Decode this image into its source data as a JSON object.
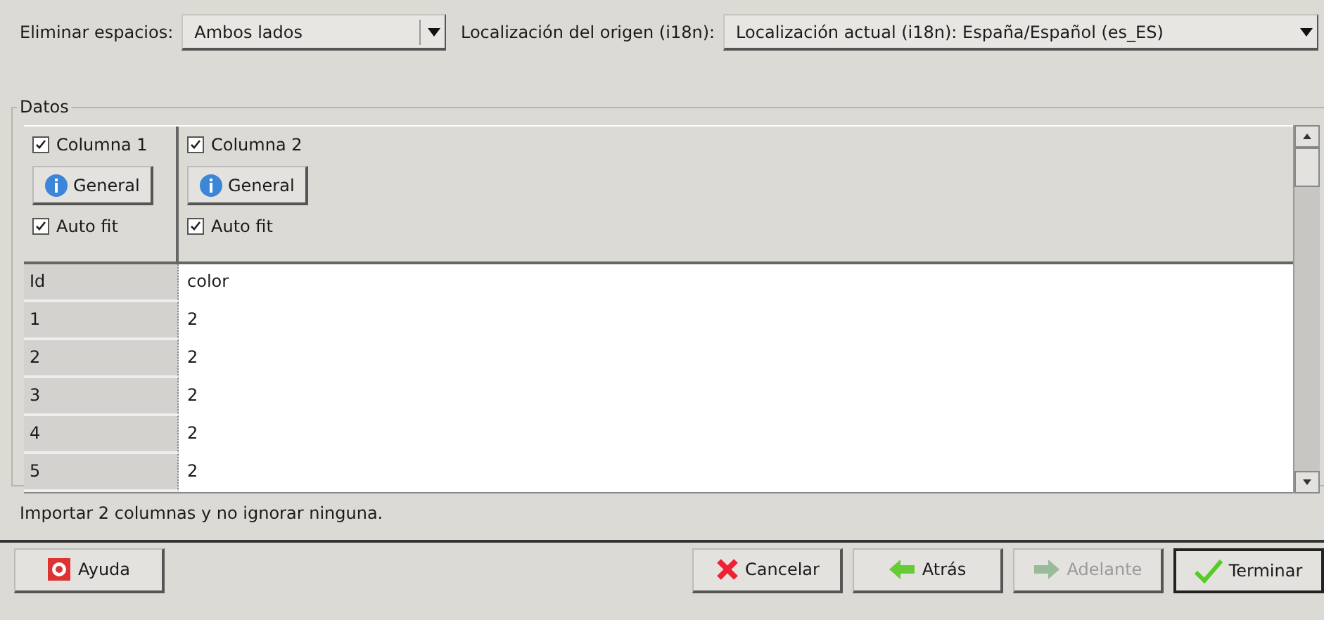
{
  "options": [
    {
      "label": "Eliminar espacios:",
      "value": "Ambos lados"
    },
    {
      "label": "Localización del origen (i18n):",
      "value": "Localización actual (i18n): España/Español (es_ES)"
    }
  ],
  "frame": {
    "title": "Datos"
  },
  "columns": [
    {
      "label": "Columna 1",
      "checked": true,
      "format": "General",
      "autofit_label": "Auto fit",
      "autofit": true
    },
    {
      "label": "Columna 2",
      "checked": true,
      "format": "General",
      "autofit_label": "Auto fit",
      "autofit": true
    }
  ],
  "rows": [
    [
      "Id",
      "color"
    ],
    [
      "1",
      "2"
    ],
    [
      "2",
      "2"
    ],
    [
      "3",
      "2"
    ],
    [
      "4",
      "2"
    ],
    [
      "5",
      "2"
    ]
  ],
  "status": "Importar 2 columnas y no ignorar ninguna.",
  "buttons": [
    {
      "kind": "help",
      "label": "Ayuda",
      "disabled": false,
      "default": false
    },
    {
      "kind": "cancel",
      "label": "Cancelar",
      "disabled": false,
      "default": false
    },
    {
      "kind": "back",
      "label": "Atrás",
      "disabled": false,
      "default": false
    },
    {
      "kind": "forward",
      "label": "Adelante",
      "disabled": true,
      "default": false
    },
    {
      "kind": "finish",
      "label": "Terminar",
      "disabled": false,
      "default": true
    }
  ]
}
